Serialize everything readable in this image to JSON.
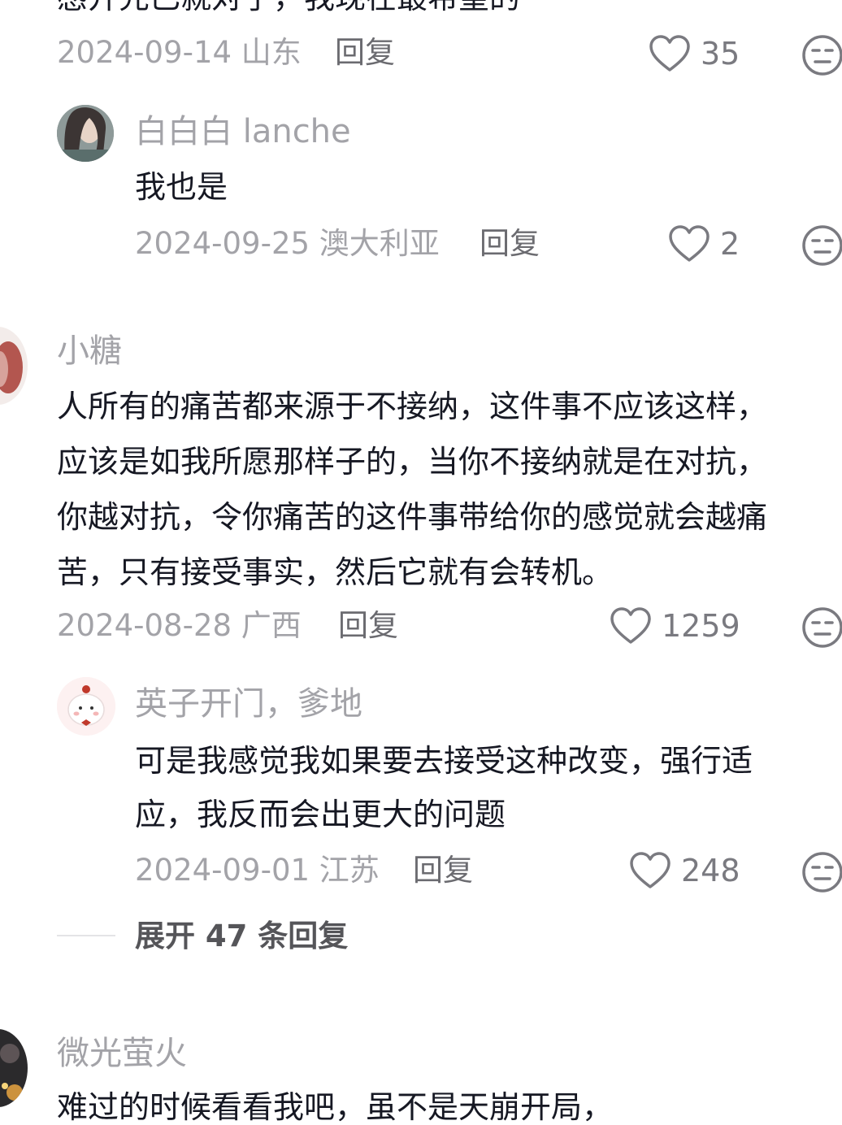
{
  "comment_prev": {
    "text_cut": "感开先已就对了，我现在最希望的",
    "date": "2024-09-14",
    "location": "山东",
    "reply_label": "回复",
    "likes": "35"
  },
  "reply_1": {
    "username": "白白白 lanche",
    "text": "我也是",
    "date": "2024-09-25",
    "location": "澳大利亚",
    "reply_label": "回复",
    "likes": "2"
  },
  "comment_2": {
    "username": "小糖",
    "lines": [
      "人所有的痛苦都来源于不接纳，这件事不应该这样，",
      "应该是如我所愿那样子的，当你不接纳就是在对抗，",
      "你越对抗，令你痛苦的这件事带给你的感觉就会越痛",
      "苦，只有接受事实，然后它就有会转机。"
    ],
    "date": "2024-08-28",
    "location": "广西",
    "reply_label": "回复",
    "likes": "1259"
  },
  "reply_2": {
    "username": "英子开门，爹地",
    "lines": [
      "可是我感觉我如果要去接受这种改变，强行适",
      "应，我反而会出更大的问题"
    ],
    "date": "2024-09-01",
    "location": "江苏",
    "reply_label": "回复",
    "likes": "248"
  },
  "expand": {
    "label": "展开 47 条回复"
  },
  "comment_3": {
    "username": "微光萤火",
    "text_cut": "难过的时候看看我吧，虽不是天崩开局，"
  },
  "colors": {
    "text": "#161823",
    "meta": "#a3a3a8",
    "reply": "#6b6b70"
  },
  "icons": {
    "like": "heart-outline-icon",
    "dislike": "neutral-face-icon"
  }
}
